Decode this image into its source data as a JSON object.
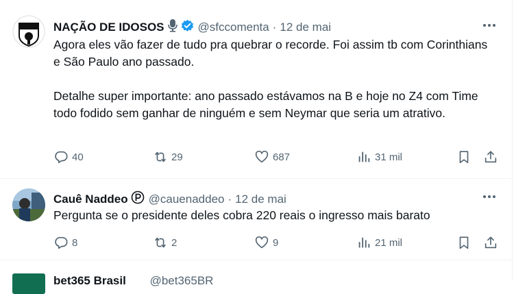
{
  "tweets": [
    {
      "author_name": "NAÇÃO DE IDOSOS",
      "handle": "@sfccomenta",
      "separator": "·",
      "date": "12 de mai",
      "text": "Agora eles vão fazer de tudo pra quebrar o recorde. Foi assim tb com Corinthians e São Paulo ano passado.\n\nDetalhe super importante: ano passado estávamos na B e hoje no Z4 com Time todo fodido sem ganhar de ninguém e sem Neymar que seria um atrativo.",
      "avatar_label": "S.F.C COMENTA",
      "replies": "40",
      "retweets": "29",
      "likes": "687",
      "views": "31 mil"
    },
    {
      "author_name": "Cauê Naddeo",
      "handle": "@cauenaddeo",
      "separator": "·",
      "date": "12 de mai",
      "text": "Pergunta se o presidente deles cobra 220 reais o ingresso mais barato",
      "replies": "8",
      "retweets": "2",
      "likes": "9",
      "views": "21 mil"
    },
    {
      "author_name": "bet365 Brasil",
      "handle": "@bet365BR"
    }
  ],
  "colors": {
    "verified": "#1d9bf0",
    "muted": "#536471",
    "text": "#0f1419",
    "bet365_green": "#126e51"
  }
}
